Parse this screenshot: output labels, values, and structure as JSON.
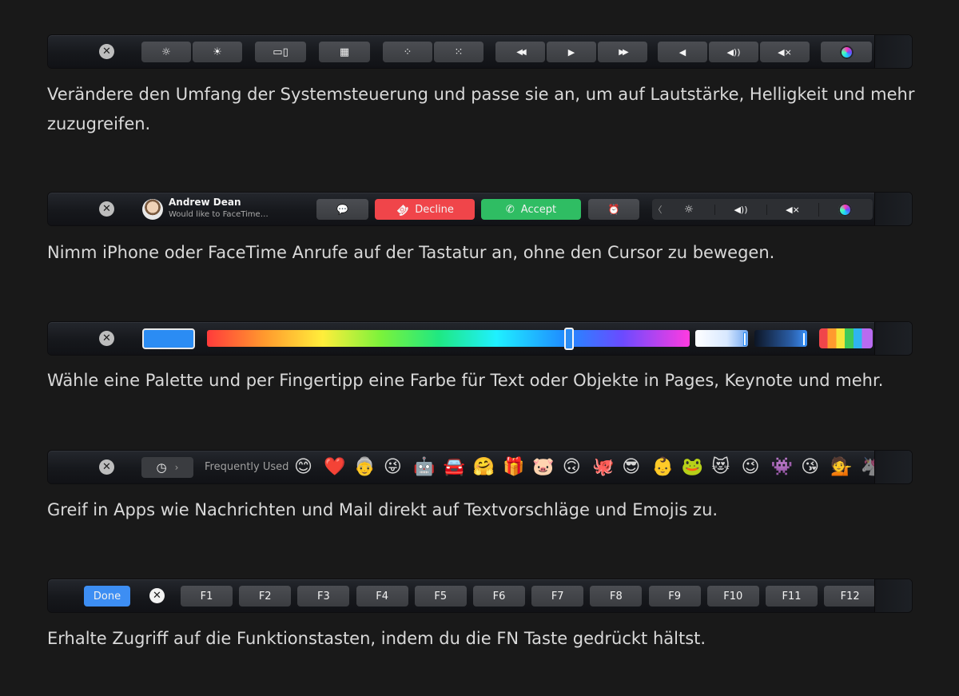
{
  "bar1": {
    "close_glyph": "✕",
    "keys": [
      {
        "glyph": "☼",
        "icon": "brightness-down-icon"
      },
      {
        "glyph": "☀",
        "icon": "brightness-up-icon"
      },
      {
        "glyph": "▭▯",
        "icon": "mission-control-icon"
      },
      {
        "glyph": "▦",
        "icon": "launchpad-icon"
      },
      {
        "glyph": "⁘",
        "icon": "keyboard-light-down-icon"
      },
      {
        "glyph": "⁙",
        "icon": "keyboard-light-up-icon"
      },
      {
        "glyph": "◀◀",
        "icon": "rewind-icon"
      },
      {
        "glyph": "▶",
        "icon": "play-icon"
      },
      {
        "glyph": "▶▶",
        "icon": "fast-forward-icon"
      },
      {
        "glyph": "◀",
        "icon": "volume-down-icon"
      },
      {
        "glyph": "◀))",
        "icon": "volume-up-icon"
      },
      {
        "glyph": "◀⨯",
        "icon": "mute-icon"
      }
    ],
    "caption": "Verändere den Umfang der Systemsteuerung und passe sie an, um auf Lautstärke, Helligkeit und mehr zuzugreifen."
  },
  "bar2": {
    "caller_name": "Andrew Dean",
    "caller_status": "Would like to FaceTime…",
    "message_glyph": "💬",
    "decline_label": "Decline",
    "decline_glyph": "☎",
    "accept_label": "Accept",
    "accept_glyph": "✆",
    "alarm_glyph": "⏰",
    "chevron_glyph": "〈",
    "brightness_glyph": "☼",
    "volume_glyph": "◀))",
    "mute_glyph": "◀⨯",
    "decline_color": "#f0454a",
    "accept_color": "#2fbd63",
    "caption": "Nimm iPhone oder FaceTime Anrufe auf der Tastatur an, ohne den Cursor zu bewegen."
  },
  "bar3": {
    "selected_color": "#2b8cf3",
    "hue_slider_value": 0.75,
    "caption": "Wähle eine Palette und per Fingertipp eine Farbe für Text oder Objekte in Pages, Keynote und mehr."
  },
  "bar4": {
    "clock_glyph": "◷",
    "chevron_glyph": "›",
    "label": "Frequently Used",
    "emojis": [
      "😊",
      "❤️",
      "👵",
      "😜",
      "🤖",
      "🚘",
      "🤗",
      "🎁",
      "🐷",
      "🙃",
      "🐙",
      "😎",
      "👶",
      "🐸",
      "😻",
      "😉",
      "👾",
      "😘",
      "💁",
      "🦄"
    ],
    "caption": "Greif in Apps wie Nachrichten und Mail direkt auf Textvorschläge und Emojis zu."
  },
  "bar5": {
    "done_label": "Done",
    "close_glyph": "✕",
    "fkeys": [
      "F1",
      "F2",
      "F3",
      "F4",
      "F5",
      "F6",
      "F7",
      "F8",
      "F9",
      "F10",
      "F11",
      "F12"
    ],
    "caption": "Erhalte Zugriff auf die Funktionstasten, indem du die FN Taste gedrückt hältst."
  }
}
